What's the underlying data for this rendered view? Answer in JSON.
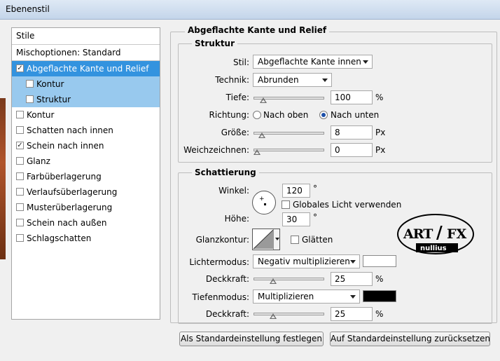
{
  "window": {
    "title": "Ebenenstil"
  },
  "sidebar": {
    "header": "Stile",
    "blend_options": "Mischoptionen: Standard",
    "items": [
      {
        "label": "Abgeflachte Kante und Relief",
        "checked": true,
        "state": "active"
      },
      {
        "label": "Kontur",
        "checked": false,
        "state": "sub"
      },
      {
        "label": "Struktur",
        "checked": false,
        "state": "sub"
      },
      {
        "label": "Kontur",
        "checked": false,
        "state": "normal"
      },
      {
        "label": "Schatten nach innen",
        "checked": false,
        "state": "normal"
      },
      {
        "label": "Schein nach innen",
        "checked": true,
        "state": "normal"
      },
      {
        "label": "Glanz",
        "checked": false,
        "state": "normal"
      },
      {
        "label": "Farbüberlagerung",
        "checked": false,
        "state": "normal"
      },
      {
        "label": "Verlaufsüberlagerung",
        "checked": false,
        "state": "normal"
      },
      {
        "label": "Musterüberlagerung",
        "checked": false,
        "state": "normal"
      },
      {
        "label": "Schein nach außen",
        "checked": false,
        "state": "normal"
      },
      {
        "label": "Schlagschatten",
        "checked": false,
        "state": "normal"
      }
    ],
    "check_mark": "✓"
  },
  "bevel": {
    "title": "Abgeflachte Kante und Relief",
    "structure": {
      "title": "Struktur",
      "style_label": "Stil:",
      "style_value": "Abgeflachte Kante innen",
      "technique_label": "Technik:",
      "technique_value": "Abrunden",
      "depth_label": "Tiefe:",
      "depth_value": "100",
      "depth_unit": "%",
      "depth_level": 0.1,
      "direction_label": "Richtung:",
      "direction_up": "Nach oben",
      "direction_down": "Nach unten",
      "direction_selected": "Nach unten",
      "size_label": "Größe:",
      "size_value": "8",
      "size_unit": "Px",
      "size_level": 0.08,
      "soften_label": "Weichzeichnen:",
      "soften_value": "0",
      "soften_unit": "Px",
      "soften_level": 0
    },
    "shading": {
      "title": "Schattierung",
      "angle_label": "Winkel:",
      "angle_value": "120",
      "angle_unit": "°",
      "global_light_label": "Globales Licht verwenden",
      "global_light_checked": false,
      "altitude_label": "Höhe:",
      "altitude_value": "30",
      "altitude_unit": "°",
      "gloss_label": "Glanzkontur:",
      "antialias_label": "Glätten",
      "antialias_checked": false,
      "highlight_mode_label": "Lichtermodus:",
      "highlight_mode_value": "Negativ multiplizieren",
      "highlight_color": "#ffffff",
      "highlight_opacity_label": "Deckkraft:",
      "highlight_opacity_value": "25",
      "highlight_opacity_unit": "%",
      "highlight_opacity_level": 0.25,
      "shadow_mode_label": "Tiefenmodus:",
      "shadow_mode_value": "Multiplizieren",
      "shadow_color": "#000000",
      "shadow_opacity_label": "Deckkraft:",
      "shadow_opacity_value": "25",
      "shadow_opacity_unit": "%",
      "shadow_opacity_level": 0.25
    }
  },
  "logo": {
    "line1": "ART",
    "slash": "/",
    "line2": "FX",
    "sub": "nullius"
  },
  "footer": {
    "make_default": "Als Standardeinstellung festlegen",
    "reset_default": "Auf Standardeinstellung zurücksetzen"
  }
}
